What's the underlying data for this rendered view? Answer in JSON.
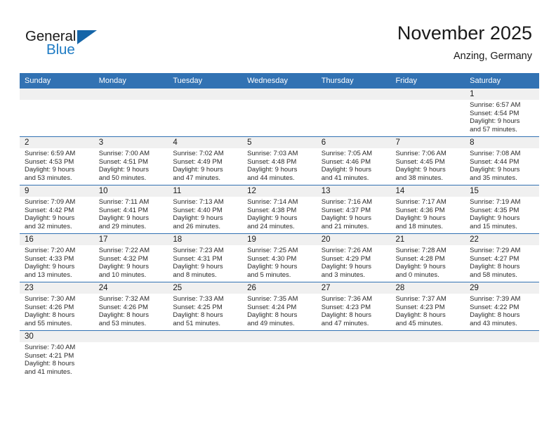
{
  "brand": {
    "name_part1": "General",
    "name_part2": "Blue",
    "triangle_icon": "triangle-icon",
    "color_black": "#1a1a1a",
    "color_blue": "#1e7bc4"
  },
  "header": {
    "title": "November 2025",
    "subtitle": "Anzing, Germany"
  },
  "theme": {
    "header_bar": "#3272b3",
    "number_band": "#f0f0f0",
    "row_divider": "#3272b3",
    "text": "#1a1a1a"
  },
  "weekday_headers": [
    "Sunday",
    "Monday",
    "Tuesday",
    "Wednesday",
    "Thursday",
    "Friday",
    "Saturday"
  ],
  "weeks": [
    [
      {
        "day": "",
        "sunrise": "",
        "sunset": "",
        "daylight1": "",
        "daylight2": ""
      },
      {
        "day": "",
        "sunrise": "",
        "sunset": "",
        "daylight1": "",
        "daylight2": ""
      },
      {
        "day": "",
        "sunrise": "",
        "sunset": "",
        "daylight1": "",
        "daylight2": ""
      },
      {
        "day": "",
        "sunrise": "",
        "sunset": "",
        "daylight1": "",
        "daylight2": ""
      },
      {
        "day": "",
        "sunrise": "",
        "sunset": "",
        "daylight1": "",
        "daylight2": ""
      },
      {
        "day": "",
        "sunrise": "",
        "sunset": "",
        "daylight1": "",
        "daylight2": ""
      },
      {
        "day": "1",
        "sunrise": "Sunrise: 6:57 AM",
        "sunset": "Sunset: 4:54 PM",
        "daylight1": "Daylight: 9 hours",
        "daylight2": "and 57 minutes."
      }
    ],
    [
      {
        "day": "2",
        "sunrise": "Sunrise: 6:59 AM",
        "sunset": "Sunset: 4:53 PM",
        "daylight1": "Daylight: 9 hours",
        "daylight2": "and 53 minutes."
      },
      {
        "day": "3",
        "sunrise": "Sunrise: 7:00 AM",
        "sunset": "Sunset: 4:51 PM",
        "daylight1": "Daylight: 9 hours",
        "daylight2": "and 50 minutes."
      },
      {
        "day": "4",
        "sunrise": "Sunrise: 7:02 AM",
        "sunset": "Sunset: 4:49 PM",
        "daylight1": "Daylight: 9 hours",
        "daylight2": "and 47 minutes."
      },
      {
        "day": "5",
        "sunrise": "Sunrise: 7:03 AM",
        "sunset": "Sunset: 4:48 PM",
        "daylight1": "Daylight: 9 hours",
        "daylight2": "and 44 minutes."
      },
      {
        "day": "6",
        "sunrise": "Sunrise: 7:05 AM",
        "sunset": "Sunset: 4:46 PM",
        "daylight1": "Daylight: 9 hours",
        "daylight2": "and 41 minutes."
      },
      {
        "day": "7",
        "sunrise": "Sunrise: 7:06 AM",
        "sunset": "Sunset: 4:45 PM",
        "daylight1": "Daylight: 9 hours",
        "daylight2": "and 38 minutes."
      },
      {
        "day": "8",
        "sunrise": "Sunrise: 7:08 AM",
        "sunset": "Sunset: 4:44 PM",
        "daylight1": "Daylight: 9 hours",
        "daylight2": "and 35 minutes."
      }
    ],
    [
      {
        "day": "9",
        "sunrise": "Sunrise: 7:09 AM",
        "sunset": "Sunset: 4:42 PM",
        "daylight1": "Daylight: 9 hours",
        "daylight2": "and 32 minutes."
      },
      {
        "day": "10",
        "sunrise": "Sunrise: 7:11 AM",
        "sunset": "Sunset: 4:41 PM",
        "daylight1": "Daylight: 9 hours",
        "daylight2": "and 29 minutes."
      },
      {
        "day": "11",
        "sunrise": "Sunrise: 7:13 AM",
        "sunset": "Sunset: 4:40 PM",
        "daylight1": "Daylight: 9 hours",
        "daylight2": "and 26 minutes."
      },
      {
        "day": "12",
        "sunrise": "Sunrise: 7:14 AM",
        "sunset": "Sunset: 4:38 PM",
        "daylight1": "Daylight: 9 hours",
        "daylight2": "and 24 minutes."
      },
      {
        "day": "13",
        "sunrise": "Sunrise: 7:16 AM",
        "sunset": "Sunset: 4:37 PM",
        "daylight1": "Daylight: 9 hours",
        "daylight2": "and 21 minutes."
      },
      {
        "day": "14",
        "sunrise": "Sunrise: 7:17 AM",
        "sunset": "Sunset: 4:36 PM",
        "daylight1": "Daylight: 9 hours",
        "daylight2": "and 18 minutes."
      },
      {
        "day": "15",
        "sunrise": "Sunrise: 7:19 AM",
        "sunset": "Sunset: 4:35 PM",
        "daylight1": "Daylight: 9 hours",
        "daylight2": "and 15 minutes."
      }
    ],
    [
      {
        "day": "16",
        "sunrise": "Sunrise: 7:20 AM",
        "sunset": "Sunset: 4:33 PM",
        "daylight1": "Daylight: 9 hours",
        "daylight2": "and 13 minutes."
      },
      {
        "day": "17",
        "sunrise": "Sunrise: 7:22 AM",
        "sunset": "Sunset: 4:32 PM",
        "daylight1": "Daylight: 9 hours",
        "daylight2": "and 10 minutes."
      },
      {
        "day": "18",
        "sunrise": "Sunrise: 7:23 AM",
        "sunset": "Sunset: 4:31 PM",
        "daylight1": "Daylight: 9 hours",
        "daylight2": "and 8 minutes."
      },
      {
        "day": "19",
        "sunrise": "Sunrise: 7:25 AM",
        "sunset": "Sunset: 4:30 PM",
        "daylight1": "Daylight: 9 hours",
        "daylight2": "and 5 minutes."
      },
      {
        "day": "20",
        "sunrise": "Sunrise: 7:26 AM",
        "sunset": "Sunset: 4:29 PM",
        "daylight1": "Daylight: 9 hours",
        "daylight2": "and 3 minutes."
      },
      {
        "day": "21",
        "sunrise": "Sunrise: 7:28 AM",
        "sunset": "Sunset: 4:28 PM",
        "daylight1": "Daylight: 9 hours",
        "daylight2": "and 0 minutes."
      },
      {
        "day": "22",
        "sunrise": "Sunrise: 7:29 AM",
        "sunset": "Sunset: 4:27 PM",
        "daylight1": "Daylight: 8 hours",
        "daylight2": "and 58 minutes."
      }
    ],
    [
      {
        "day": "23",
        "sunrise": "Sunrise: 7:30 AM",
        "sunset": "Sunset: 4:26 PM",
        "daylight1": "Daylight: 8 hours",
        "daylight2": "and 55 minutes."
      },
      {
        "day": "24",
        "sunrise": "Sunrise: 7:32 AM",
        "sunset": "Sunset: 4:26 PM",
        "daylight1": "Daylight: 8 hours",
        "daylight2": "and 53 minutes."
      },
      {
        "day": "25",
        "sunrise": "Sunrise: 7:33 AM",
        "sunset": "Sunset: 4:25 PM",
        "daylight1": "Daylight: 8 hours",
        "daylight2": "and 51 minutes."
      },
      {
        "day": "26",
        "sunrise": "Sunrise: 7:35 AM",
        "sunset": "Sunset: 4:24 PM",
        "daylight1": "Daylight: 8 hours",
        "daylight2": "and 49 minutes."
      },
      {
        "day": "27",
        "sunrise": "Sunrise: 7:36 AM",
        "sunset": "Sunset: 4:23 PM",
        "daylight1": "Daylight: 8 hours",
        "daylight2": "and 47 minutes."
      },
      {
        "day": "28",
        "sunrise": "Sunrise: 7:37 AM",
        "sunset": "Sunset: 4:23 PM",
        "daylight1": "Daylight: 8 hours",
        "daylight2": "and 45 minutes."
      },
      {
        "day": "29",
        "sunrise": "Sunrise: 7:39 AM",
        "sunset": "Sunset: 4:22 PM",
        "daylight1": "Daylight: 8 hours",
        "daylight2": "and 43 minutes."
      }
    ],
    [
      {
        "day": "30",
        "sunrise": "Sunrise: 7:40 AM",
        "sunset": "Sunset: 4:21 PM",
        "daylight1": "Daylight: 8 hours",
        "daylight2": "and 41 minutes."
      },
      {
        "day": "",
        "sunrise": "",
        "sunset": "",
        "daylight1": "",
        "daylight2": ""
      },
      {
        "day": "",
        "sunrise": "",
        "sunset": "",
        "daylight1": "",
        "daylight2": ""
      },
      {
        "day": "",
        "sunrise": "",
        "sunset": "",
        "daylight1": "",
        "daylight2": ""
      },
      {
        "day": "",
        "sunrise": "",
        "sunset": "",
        "daylight1": "",
        "daylight2": ""
      },
      {
        "day": "",
        "sunrise": "",
        "sunset": "",
        "daylight1": "",
        "daylight2": ""
      },
      {
        "day": "",
        "sunrise": "",
        "sunset": "",
        "daylight1": "",
        "daylight2": ""
      }
    ]
  ]
}
